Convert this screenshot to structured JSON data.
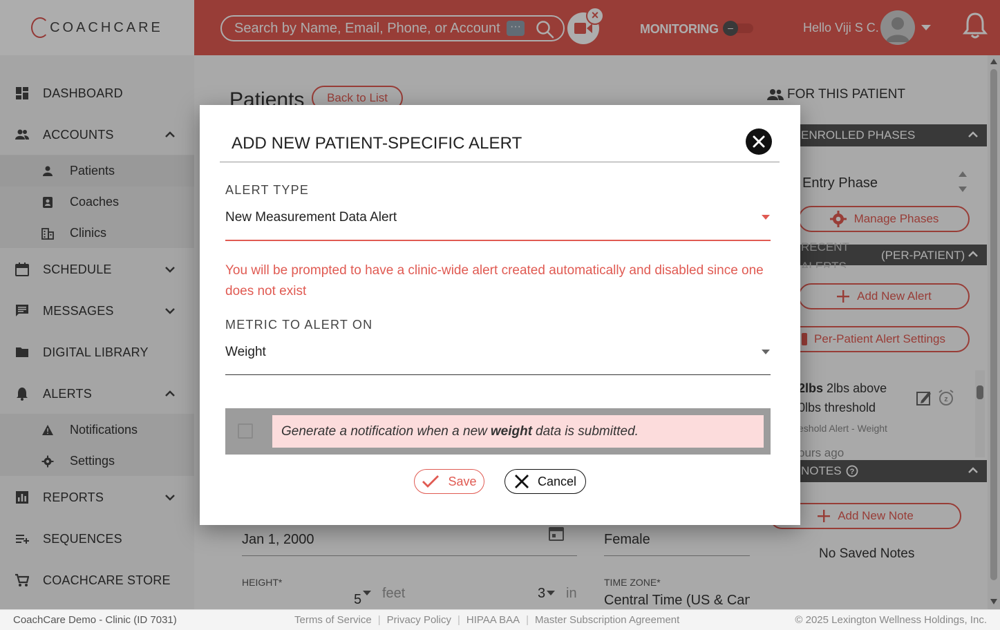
{
  "header": {
    "logo_text": "COACHCARE",
    "search_placeholder": "Search by Name, Email, Phone, or Account ID",
    "dots": "···",
    "monitoring_label": "MONITORING",
    "greeting": "Hello Viji S C."
  },
  "sidebar": {
    "items": [
      {
        "label": "DASHBOARD",
        "icon": "dashboard-icon"
      },
      {
        "label": "ACCOUNTS",
        "icon": "people-icon"
      },
      {
        "label": "SCHEDULE",
        "icon": "calendar-icon"
      },
      {
        "label": "MESSAGES",
        "icon": "chat-icon"
      },
      {
        "label": "DIGITAL LIBRARY",
        "icon": "folder-icon"
      },
      {
        "label": "ALERTS",
        "icon": "bell-icon"
      },
      {
        "label": "REPORTS",
        "icon": "chart-icon"
      },
      {
        "label": "SEQUENCES",
        "icon": "playlist-icon"
      },
      {
        "label": "COACHCARE STORE",
        "icon": "cart-icon"
      }
    ],
    "accounts_sub": [
      {
        "label": "Patients",
        "icon": "person-icon"
      },
      {
        "label": "Coaches",
        "icon": "badge-icon"
      },
      {
        "label": "Clinics",
        "icon": "building-icon"
      }
    ],
    "alerts_sub": [
      {
        "label": "Notifications",
        "icon": "warning-icon"
      },
      {
        "label": "Settings",
        "icon": "gear-icon"
      }
    ]
  },
  "main": {
    "title": "Patients",
    "back_label": "Back to List",
    "dob": "Jan 1, 2000",
    "gender": "Female",
    "height_label": "HEIGHT*",
    "feet_value": "5",
    "feet_label": "feet",
    "inches_value": "3",
    "inches_label": "in",
    "timezone_label": "TIME ZONE*",
    "timezone_value": "Central Time (US & Canada)"
  },
  "right_panel": {
    "title": "FOR THIS PATIENT",
    "enrolled_phases": "ENROLLED PHASES",
    "entry_phase": "Entry Phase",
    "manage_phases": "Manage Phases",
    "recent_alerts": "RECENT ALERTS",
    "per_patient": "(PER-PATIENT)",
    "add_new_alert": "Add New Alert",
    "alert_settings": "Per-Patient Alert Settings",
    "alert_line1_bold": "2lbs",
    "alert_line1": "2lbs above",
    "alert_line2": "0lbs threshold",
    "alert_type_small": "eshold Alert - Weight",
    "alert_time": "ours ago",
    "notes": "NOTES",
    "add_new_note": "Add New Note",
    "no_notes": "No Saved Notes"
  },
  "footer": {
    "clinic": "CoachCare Demo - Clinic (ID 7031)",
    "links": [
      "Terms of Service",
      "Privacy Policy",
      "HIPAA BAA",
      "Master Subscription Agreement"
    ],
    "copyright": "© 2025 Lexington Wellness Holdings, Inc."
  },
  "modal": {
    "title": "ADD NEW PATIENT-SPECIFIC ALERT",
    "alert_type_label": "ALERT TYPE",
    "alert_type_value": "New Measurement Data Alert",
    "warning": "You will be prompted to have a clinic-wide alert created automatically and disabled since one does not exist",
    "metric_label": "METRIC TO ALERT ON",
    "metric_value": "Weight",
    "notif_prefix": "Generate a notification when a new",
    "notif_bold": "weight",
    "notif_suffix": "data is submitted.",
    "save_label": "Save",
    "cancel_label": "Cancel"
  },
  "colors": {
    "brand": "#e05a52",
    "dark": "#555555"
  }
}
